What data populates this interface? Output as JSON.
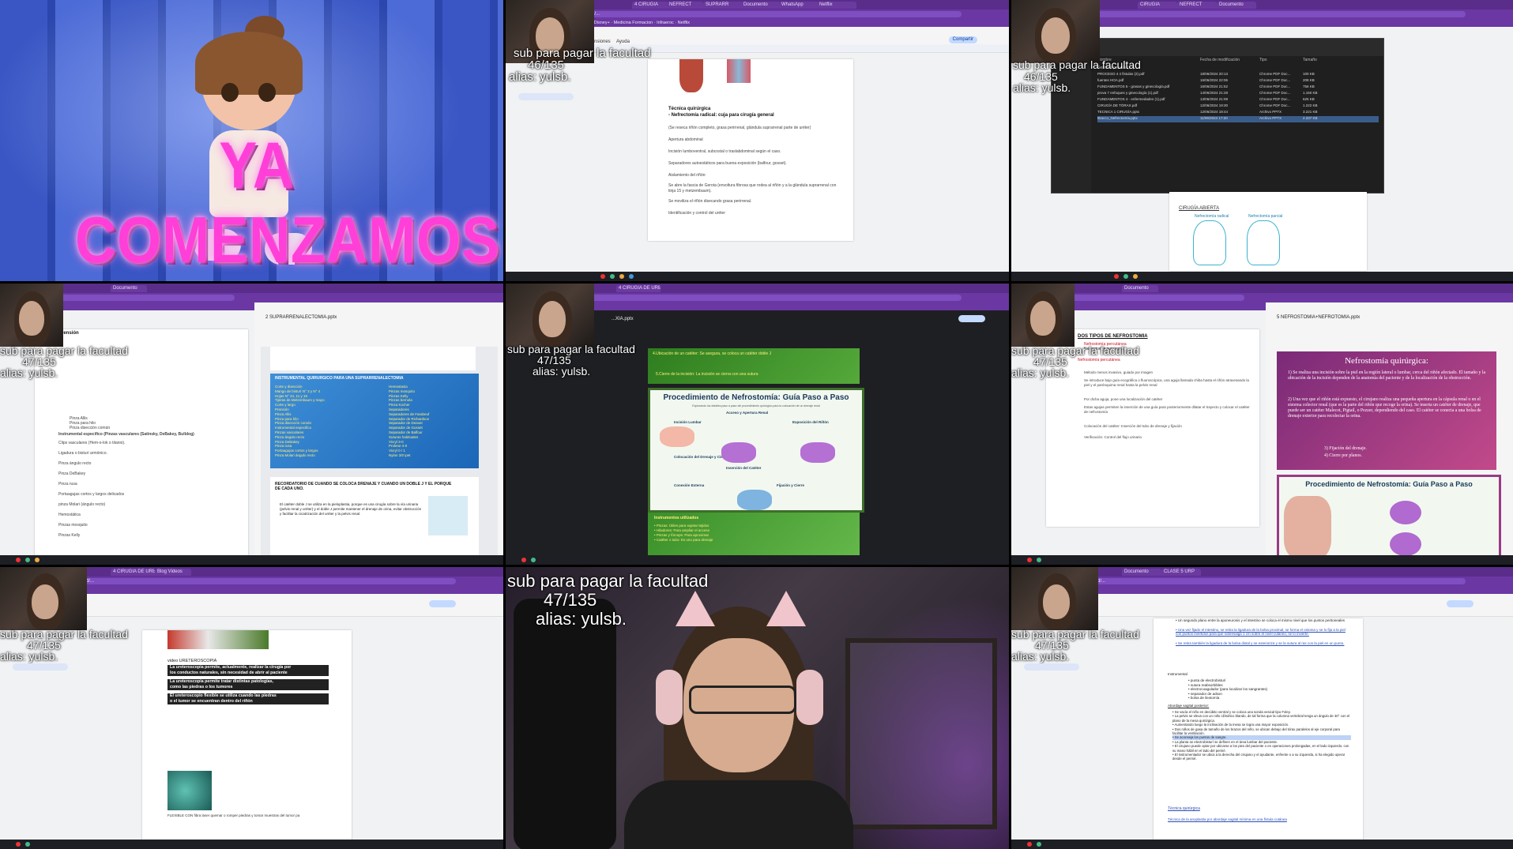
{
  "cells": {
    "intro": {
      "title": "YA COMENZAMOS"
    },
    "overlay": {
      "line1": "sub para pagar la facultad",
      "count_46": "46/135",
      "count_47": "47/135",
      "alias": "alias: yulsb."
    },
    "doc1": {
      "title": "Técnica quirúrgica",
      "subtitle": "- Nefrectomía radical: cuja para cirugía general",
      "lines": [
        "(Se reseca riñón completo, grasa perirrenal, glándula suprarrenal parte de uréter)",
        "Apertura abdominal",
        "Incisión lumboventral, subcostal o traslabdominal según el caso.",
        "Separadores autoestáticos para buena exposición (balfour, gosset).",
        "Aislamiento del riñón:",
        "Se abre la fascia de Gerota (envoltura fibrosa que rodea al riñón y a la glándula suprarrenal con tinja 15 y metzembaum).",
        "Se moviliza el riñón disecando grasa perirrenal.",
        "Identificación y control del uréter"
      ],
      "share": "Compartir",
      "menu": [
        "Extensiones",
        "Ayuda"
      ]
    },
    "explorer": {
      "columns": [
        "Nombre",
        "Fecha de modificación",
        "Tipo",
        "Tamaño"
      ],
      "group": "Semana pasada (13)",
      "files": [
        [
          "PROCESO 4 4 fistulas (2).pdf",
          "18/06/2024 20:13",
          "Chrome PDF Doc...",
          "100 KB"
        ],
        [
          "fuentes HOA.pdf",
          "16/06/2024 22:06",
          "Chrome PDF Doc...",
          "208 KB"
        ],
        [
          "FUNDAMENTOS 5 - grasas y ginecología.pdf",
          "16/06/2024 21:52",
          "Chrome PDF Doc...",
          "756 KB"
        ],
        [
          "prova 7 enfoques y ginecología (1).pdf",
          "14/06/2024 21:28",
          "Chrome PDF Doc...",
          "1.150 KB"
        ],
        [
          "FUNDAMENTOS 4 - enfermedades (1).pdf",
          "13/06/2024 21:09",
          "Chrome PDF Doc...",
          "625 KB"
        ],
        [
          "CIRUGÍA DE TÓRAX.pdf",
          "12/06/2024 19:30",
          "Chrome PDF Doc...",
          "1.222 KB"
        ],
        [
          "TECNICA 1 CIRUGÍA.pptx",
          "12/06/2024 18:44",
          "Archivo PPTX",
          "3.221 KB"
        ],
        [
          "Bracco_Nefrectomía.pptx",
          "11/06/2024 17:20",
          "Archivo PPTX",
          "2.337 KB"
        ]
      ],
      "section_title": "CIRUGÍA ABIERTA",
      "diagram_labels": [
        "Nefrectomía radical",
        "Nefrectomía parcial"
      ]
    },
    "doc4": {
      "header": "Prensión",
      "lines": [
        "Pinza Allis",
        "Pinza para hilo",
        "Pinza disección común",
        "Instrumental especifico (Pinzas vasculares (Satinsky, DeBakey, Bulldog)",
        "Clips vasculares (Hem-o-lok o titanio).",
        "Ligadura o bisturí armónico.",
        "Pinza ángulo recto",
        "Pinza DeBakey",
        "Pinza rusa",
        "Portaagujas cortos y largos delicados",
        "pinza Molari (ángulo recto)",
        "Hemostática",
        "Pinzas mosquito",
        "Pinzas Kelly"
      ]
    },
    "slides4": {
      "file": "2 SUPRARRENALECTOMIA.pptx",
      "heading": "INSTRUMENTAL QUIRURGICO PARA UNA SUPRARRENALECTOMIA",
      "left_list": [
        "Corte y disección",
        "Mango de bisturí N° 3 y N° 4",
        "Hojas N° 24, 11 y 15",
        "Tijeras de Metzenbaum y mayo",
        "Corte y largo",
        "Prensión",
        "Pinza Allis",
        "Pinza para hilo",
        "Pinza disección común",
        "Instrumental especifico",
        "Pinzas vasculares",
        "Pinza ángulo recto",
        "Pinza DeBakey",
        "Pinza rusa",
        "Portaagujas cortos y largos",
        "Pinza Molari ángulo recto"
      ],
      "right_list": [
        "Hemostasia",
        "Pinzas mosquito",
        "Pinzas Kelly",
        "Pinzas bernola",
        "Pinza Kocher",
        "Separadores",
        "Separadores de Farabeuf",
        "Separador de Richardson",
        "Separador de Deaver",
        "Separador de Gosset",
        "Separador de Balfour",
        "Suturas habituales",
        "Vicryl 3-0",
        "Prolene 4-0",
        "Vicryl 0 / 1",
        "Nylon 3/0 ipet"
      ],
      "caption": "RECORDATORIO DE CUANDO SE COLOCA DRENAJE Y CUANDO UN DOBLE J Y EL PORQUE DE CADA UNO.",
      "body": "El catéter doble J se utiliza en la pieloplastia, porque es una cirugía sobre la vía urinaria (pelvis renal y uréter) y el doble J permite mantener el drenaje de orina, evitar obstrucción y facilitar la cicatrización del uréter y la pelvis renal."
    },
    "slides5": {
      "file": "...XIA.pptx",
      "top_text": "4.Ubicación de un catéter: Se asegura, se coloca un catéter doble J",
      "top_text2": "5.Cierre de la incisión: La incisión se cierra con una sutura",
      "infographic_title": "Procedimiento de Nefrostomía: Guía Paso a Paso",
      "infographic_sub": "Explorando los detalles paso a paso del procedimiento quirúrgico para la colocación de un drenaje renal",
      "steps": [
        "Acceso y Apertura Renal",
        "Incisión Lumbar",
        "Exposición del Riñón",
        "Colocación del Drenaje y Cierre",
        "Inserción del Catéter",
        "Conexión Externa",
        "Fijación y Cierre"
      ],
      "bottom_title": "Instrumentos utilizados",
      "bottom_lines": [
        "Pinzas: Útiles para sujetar tejidos",
        "Hiladores: Para ampliar el acceso",
        "Pinzas y fórceps: Para aproximar",
        "Catéter o tubo: Es uno para drenaje"
      ]
    },
    "doc6": {
      "title": "DOS TIPOS DE NEFROSTOMIA",
      "items": [
        "Nefrostomía percutánea",
        "Nefrostomía quirúrgica"
      ],
      "sub": "Nefrostomía percutánea",
      "lines": [
        "Método menos invasivo, guiado por imagen",
        "Se introduce bajo guía ecográfica o fluoroscópica, una aguja llamada chiba hasta el riñón atravesando la piel y el parénquima renal hasta la pelvis renal",
        "Por dicha aguja, pone una localización del catéter",
        "Estas agujas permiten la inserción de una guía para posteriormente dilatar el trayecto y colocar el catéter de nefrostomía",
        "Colocación del catéter: Inserción del tubo de drenaje y fijación",
        "Verificación: Control del flujo urinario"
      ],
      "slide_title": "Nefrostomía quirúrgica:",
      "slide_p1": "1) Se realiza una incisión sobre la piel en la región lateral o lumbar, cerca del riñón afectado. El tamaño y la ubicación de la incisión dependen de la anatomía del paciente y de la localización de la obstrucción.",
      "slide_p2": "2) Una vez que el riñón está expuesto, el cirujano realiza una pequeña apertura en la cápsula renal o en el sistema colector renal (que es la parte del riñón que recoge la orina). Se inserta un catéter de drenaje, que puede ser un catéter Malecot, Pigtail, o Pezzer, dependiendo del caso. El catéter se conecta a una bolsa de drenaje exterior para recolectar la orina.",
      "slide_p3": "3) Fijación del drenaje.",
      "slide_p4": "4) Cierre por planos.",
      "infographic_title": "Procedimiento de Nefrostomía: Guía Paso a Paso",
      "file": "5 NEFROSTOMIA+NEFROTOMIA.pptx"
    },
    "doc7": {
      "video": "video URETEROSCOPIA",
      "lines": [
        "La ureteroscopia permite, actualmente, realizar la cirugía por",
        "los conductos naturales, sin necesidad de abrir al paciente",
        "La ureteroscopia permite tratar distintas patologías,",
        "como las piedras o los tumores",
        "El ureteroscopio flexible se utiliza cuando las piedras",
        "o el tumor se encuentran dentro del riñón"
      ],
      "caption": "FLEXIBLE CON fibra laser quemar o romper piedras y tomar muestras del tumor pa"
    },
    "doc9": {
      "lines_top": [
        "Un segundo plano entre la aponeurosis y el intestino se coloca el mismo nivel que los puntos peritoneales",
        "Una vez fijado el intestino, se retira la ligadura de la bolsa proximal, se forma el ostoma y se lo fija a la piel con puntos evertidos para que sobresalga 1 cm sobre el nivel cutáneo, se lo invierte.",
        "Se retira también la ligadura de la bolsa distal y se exterioriza y se la sutura al ras con la piel en un punto."
      ],
      "instrumental": "Instrumental",
      "inst_items": [
        "punta de electrobisturí",
        "sutura reabsorbibles",
        "electrocoagulador (para localizar los sangrantes)",
        "separador de adson",
        "bolsa de ileotomía"
      ],
      "abordaje": "Abordaje sagital posterior:",
      "abordaje_items": [
        "Se vacía el niño en decúbito ventral y se coloca una sonda vesical tipo Foley.",
        "La pelvis se eleva con un rollo cilíndrico blando, de tal forma que la columna vertebral tenga un ángulo de 30° con el plano de la mesa quirúrgica.",
        "Aumentando luego la inclinación de la mesa se logra una mayor exposición.",
        "Dos rollos de gasa de tamaño de los brazos del niño, se ubican debajo del tórax paralelos al eje corporal para facilitar la ventilación.",
        "Se aconseja los puntos de sangre.",
        "La planta se electrobisturí se definen en el área lumbar del paciente.",
        "El cirujano puede optar por ubicarse a los pies del paciente o en operaciones prolongadas, en el lado izquierdo, con su mano hábil en el lado del periné.",
        "El instrumentador se ubica a la derecha del cirujano y el ayudante, enfrente o a su izquierda, si ha elegido operar desde el periné."
      ],
      "footer1": "Técnica quirúrgica",
      "footer2": "Técnica de la anoplastia por abordaje sagital mínima en una fístula cutánea"
    }
  },
  "colors": {
    "chrome_purple": "#6a37a3",
    "intro_pink": "#ff3fd8",
    "slide_purple": "#a43a8c",
    "slide_green": "#3a8f2a",
    "infographic_border": "#3d6e2a"
  }
}
